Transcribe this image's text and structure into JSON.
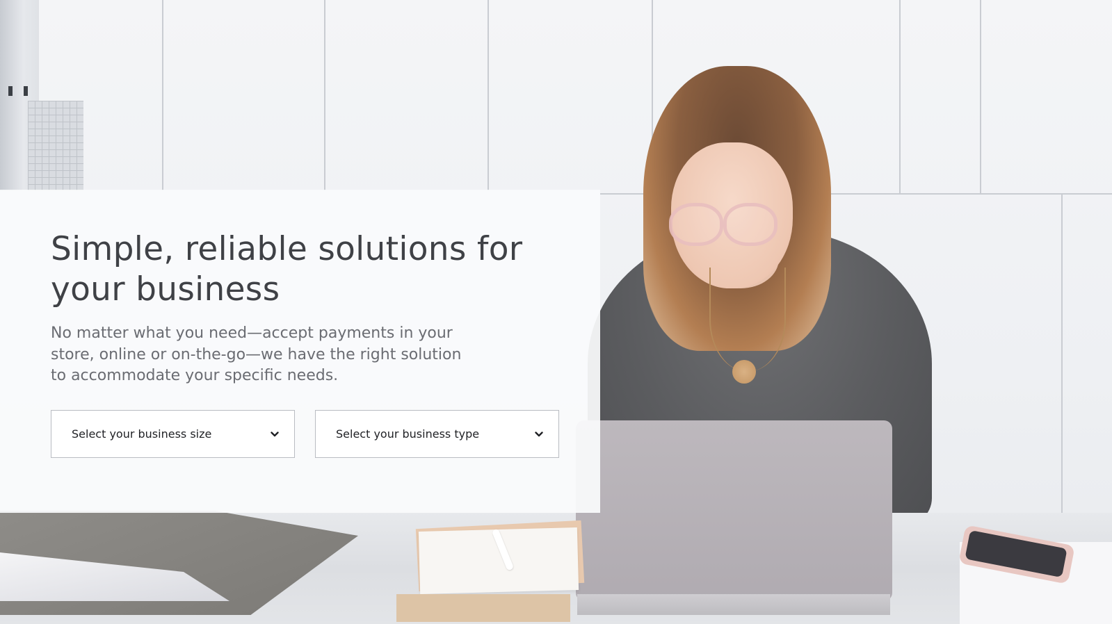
{
  "hero": {
    "headline": "Simple, reliable solutions for your business",
    "subtext": "No matter what you need—accept payments in your store, online or on-the-go—we have the right solution to accommodate your specific needs."
  },
  "selectors": {
    "business_size": {
      "placeholder": "Select your business size",
      "icon": "chevron-down-icon"
    },
    "business_type": {
      "placeholder": "Select your business type",
      "icon": "chevron-down-icon"
    }
  },
  "colors": {
    "headline": "#3f4146",
    "subtext": "#6a6c72",
    "select_border": "#b9bcc2",
    "overlay": "#fafbfc"
  }
}
